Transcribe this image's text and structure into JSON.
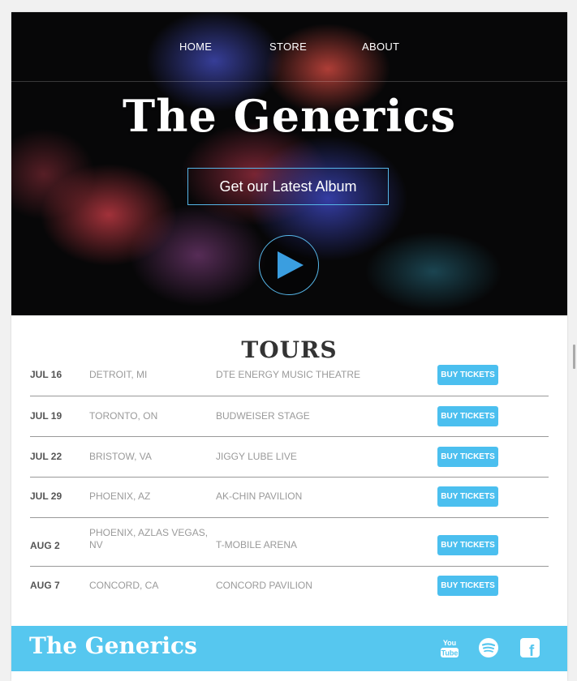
{
  "nav": {
    "home": "HOME",
    "store": "STORE",
    "about": "ABOUT"
  },
  "hero": {
    "title": "The Generics",
    "album_button": "Get our Latest Album",
    "play_icon": "play-icon"
  },
  "tours": {
    "title": "TOURS",
    "rows": [
      {
        "date": "JUL 16",
        "city": "DETROIT, MI",
        "venue": "DTE ENERGY MUSIC THEATRE",
        "button": "BUY TICKETS"
      },
      {
        "date": "JUL 19",
        "city": "TORONTO, ON",
        "venue": "BUDWEISER STAGE",
        "button": "BUY TICKETS"
      },
      {
        "date": "JUL 22",
        "city": "BRISTOW, VA",
        "venue": "JIGGY LUBE LIVE",
        "button": "BUY TICKETS"
      },
      {
        "date": "JUL 29",
        "city": "PHOENIX, AZ",
        "venue": "AK-CHIN PAVILION",
        "button": "BUY TICKETS"
      },
      {
        "date": "AUG 2",
        "city": "PHOENIX, AZLAS VEGAS, NV",
        "venue": "T-MOBILE ARENA",
        "button": "BUY TICKETS"
      },
      {
        "date": "AUG 7",
        "city": "CONCORD, CA",
        "venue": "CONCORD PAVILION",
        "button": "BUY TICKETS"
      }
    ]
  },
  "footer": {
    "logo": "The Generics",
    "social": {
      "youtube": "You Tube",
      "spotify": "spotify-icon",
      "facebook": "f"
    }
  },
  "colors": {
    "accent": "#56c7ef",
    "button": "#4bbfef",
    "border": "#56b6e8"
  }
}
